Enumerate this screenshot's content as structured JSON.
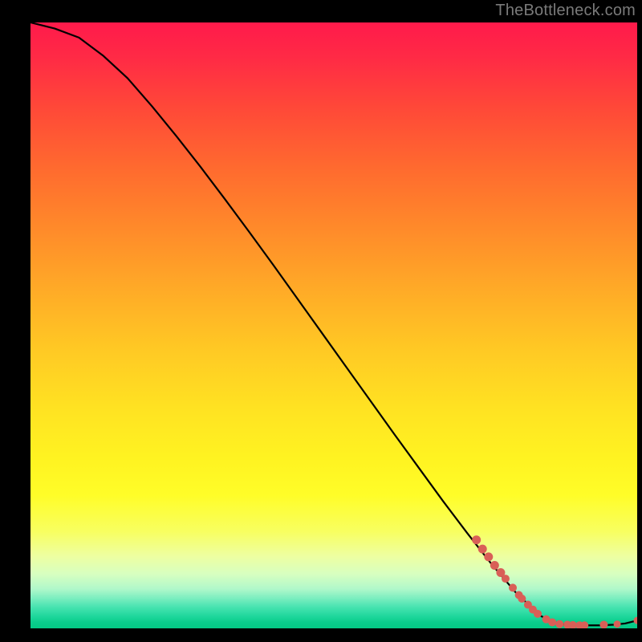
{
  "attribution": "TheBottleneck.com",
  "chart_data": {
    "type": "line",
    "title": "",
    "xlabel": "",
    "ylabel": "",
    "xlim": [
      0,
      100
    ],
    "ylim": [
      0,
      100
    ],
    "series": [
      {
        "name": "bottleneck-curve",
        "x": [
          0,
          4,
          8,
          12,
          16,
          20,
          24,
          28,
          32,
          36,
          40,
          44,
          48,
          52,
          56,
          60,
          64,
          68,
          72,
          76,
          80,
          84,
          86,
          88,
          90,
          92,
          94,
          96,
          98,
          100
        ],
        "y": [
          100,
          99,
          97.5,
          94.5,
          90.8,
          86.2,
          81.3,
          76.2,
          70.9,
          65.5,
          60.0,
          54.4,
          48.8,
          43.2,
          37.6,
          32.0,
          26.5,
          21.0,
          15.7,
          10.6,
          5.9,
          2.1,
          1.1,
          0.6,
          0.5,
          0.5,
          0.5,
          0.6,
          0.8,
          1.3
        ]
      }
    ],
    "markers": {
      "name": "highlighted-points",
      "color": "#d95f57",
      "points": [
        {
          "x": 73.5,
          "y": 14.6,
          "r": 5.5
        },
        {
          "x": 74.5,
          "y": 13.1,
          "r": 5.5
        },
        {
          "x": 75.5,
          "y": 11.8,
          "r": 5.5
        },
        {
          "x": 76.5,
          "y": 10.4,
          "r": 5.5
        },
        {
          "x": 77.5,
          "y": 9.2,
          "r": 5.5
        },
        {
          "x": 78.3,
          "y": 8.2,
          "r": 5.0
        },
        {
          "x": 79.5,
          "y": 6.7,
          "r": 5.0
        },
        {
          "x": 80.5,
          "y": 5.5,
          "r": 5.0
        },
        {
          "x": 81.0,
          "y": 4.9,
          "r": 5.0
        },
        {
          "x": 82.0,
          "y": 3.9,
          "r": 5.0
        },
        {
          "x": 82.8,
          "y": 3.1,
          "r": 5.0
        },
        {
          "x": 83.6,
          "y": 2.4,
          "r": 5.0
        },
        {
          "x": 85.0,
          "y": 1.5,
          "r": 5.0
        },
        {
          "x": 86.0,
          "y": 1.0,
          "r": 5.0
        },
        {
          "x": 87.2,
          "y": 0.7,
          "r": 5.0
        },
        {
          "x": 88.5,
          "y": 0.6,
          "r": 5.0
        },
        {
          "x": 89.4,
          "y": 0.55,
          "r": 5.0
        },
        {
          "x": 90.5,
          "y": 0.5,
          "r": 5.0
        },
        {
          "x": 91.3,
          "y": 0.5,
          "r": 5.0
        },
        {
          "x": 94.5,
          "y": 0.6,
          "r": 5.0
        },
        {
          "x": 96.7,
          "y": 0.7,
          "r": 4.5
        },
        {
          "x": 100.0,
          "y": 1.3,
          "r": 4.5
        }
      ]
    }
  }
}
